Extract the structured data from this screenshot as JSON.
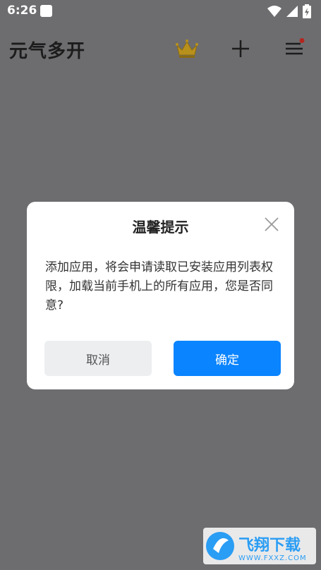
{
  "status_bar": {
    "time": "6:26"
  },
  "header": {
    "title": "元气多开",
    "crown_color": "#d4a017",
    "menu_badge_color": "#e53935"
  },
  "dialog": {
    "title": "温馨提示",
    "message": "添加应用，将会申请读取已安装应用列表权限，加载当前手机上的所有应用，您是否同意?",
    "cancel_label": "取消",
    "confirm_label": "确定",
    "accent_color": "#0a84ff"
  },
  "watermark": {
    "brand": "飞翔下载",
    "url": "WWW.FXXZ.COM"
  }
}
